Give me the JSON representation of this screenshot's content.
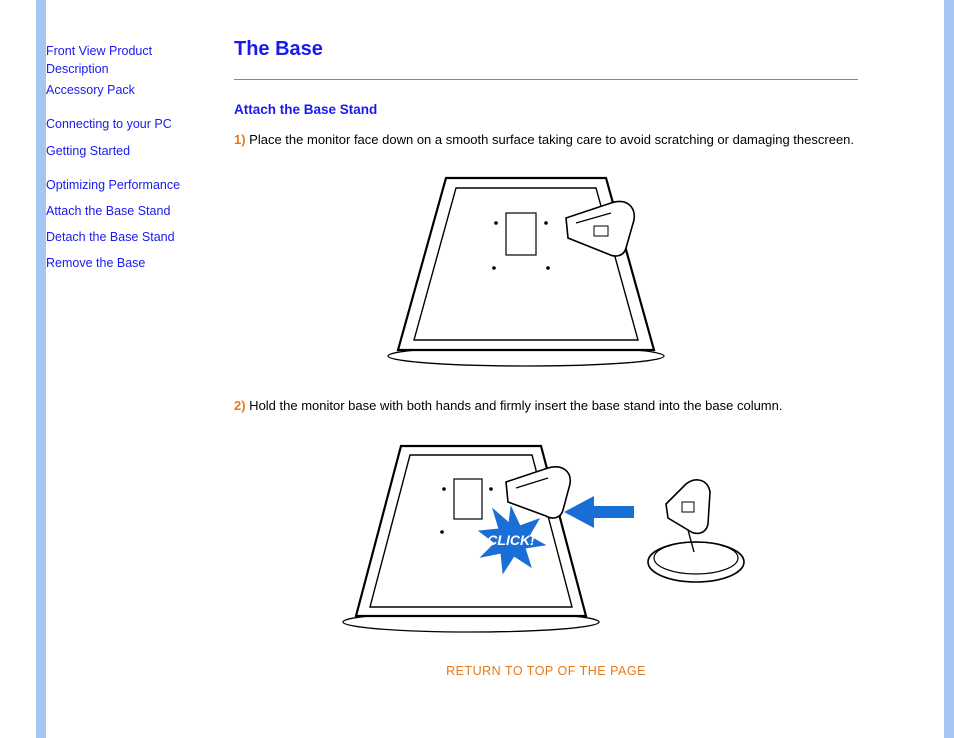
{
  "sidebar": {
    "group1": {
      "link1a": "Front View Product",
      "link1b": "Description",
      "link2": "Accessory Pack"
    },
    "group2": {
      "link1": "Connecting to your PC",
      "link2": "Getting Started"
    },
    "group3": {
      "link1": "Optimizing Performance",
      "link2": "Attach the Base Stand",
      "link3": "Detach the Base Stand",
      "link4": "Remove the Base"
    }
  },
  "content": {
    "title": "The Base",
    "subtitle": "Attach the Base Stand",
    "step1_num": "1)",
    "step1_text": " Place the monitor face down on a smooth surface taking care to avoid scratching or damaging thescreen.",
    "step2_num": "2)",
    "step2_text": " Hold the monitor base with both hands and firmly insert the base stand into the base column.",
    "click_label": "CLICK!",
    "return_link": "RETURN TO TOP OF THE PAGE"
  }
}
